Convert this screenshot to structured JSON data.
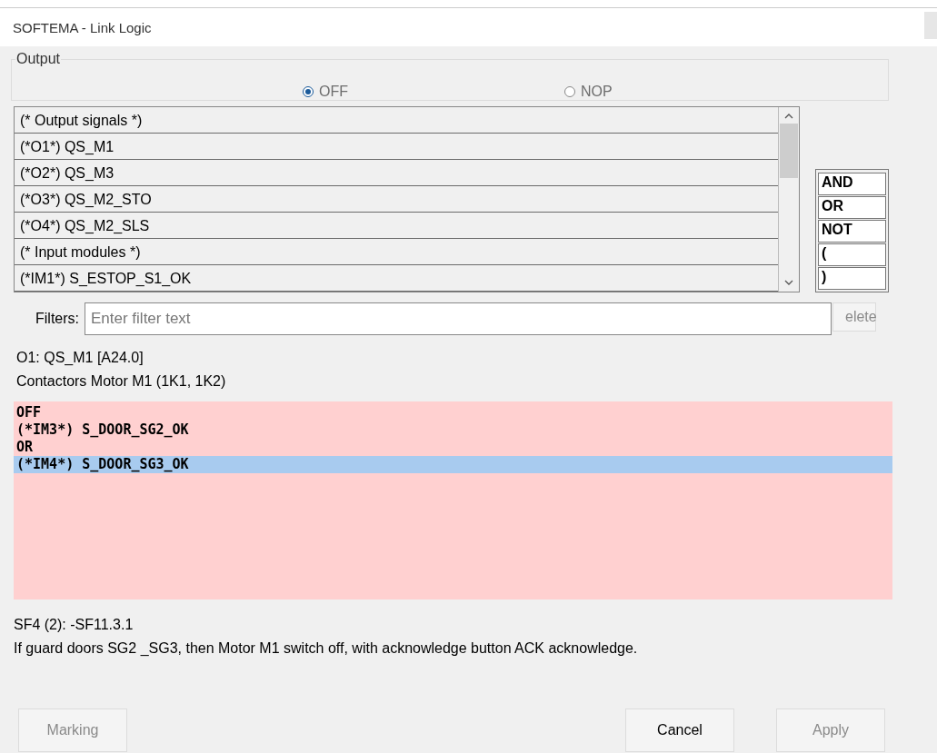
{
  "window": {
    "title": "SOFTEMA - Link Logic"
  },
  "output": {
    "label": "Output",
    "options": [
      {
        "label": "OFF",
        "selected": true
      },
      {
        "label": "NOP",
        "selected": false
      }
    ]
  },
  "signals": [
    "(* Output signals *)",
    "(*O1*) QS_M1",
    "(*O2*) QS_M3",
    "(*O3*) QS_M2_STO",
    "(*O4*) QS_M2_SLS",
    "(* Input modules *)",
    "(*IM1*) S_ESTOP_S1_OK"
  ],
  "operators": [
    "AND",
    "OR",
    "NOT",
    "(",
    ")"
  ],
  "filter": {
    "label": "Filters:",
    "placeholder": "Enter filter text"
  },
  "delete_button": {
    "label": "elete",
    "disabled": true
  },
  "info": [
    "O1: QS_M1 [A24.0]",
    "Contactors Motor M1 (1K1, 1K2)"
  ],
  "logic": [
    {
      "text": "OFF",
      "selected": false
    },
    {
      "text": "(*IM3*) S_DOOR_SG2_OK",
      "selected": false
    },
    {
      "text": "OR",
      "selected": false
    },
    {
      "text": "(*IM4*) S_DOOR_SG3_OK",
      "selected": true
    }
  ],
  "reference": "SF4 (2): -SF11.3.1",
  "description": "If guard doors SG2 _SG3, then Motor M1 switch off, with acknowledge button ACK acknowledge.",
  "buttons": [
    {
      "label": "Marking",
      "disabled": true
    },
    {
      "label": "Cancel",
      "disabled": false
    },
    {
      "label": "Apply",
      "disabled": true
    }
  ]
}
